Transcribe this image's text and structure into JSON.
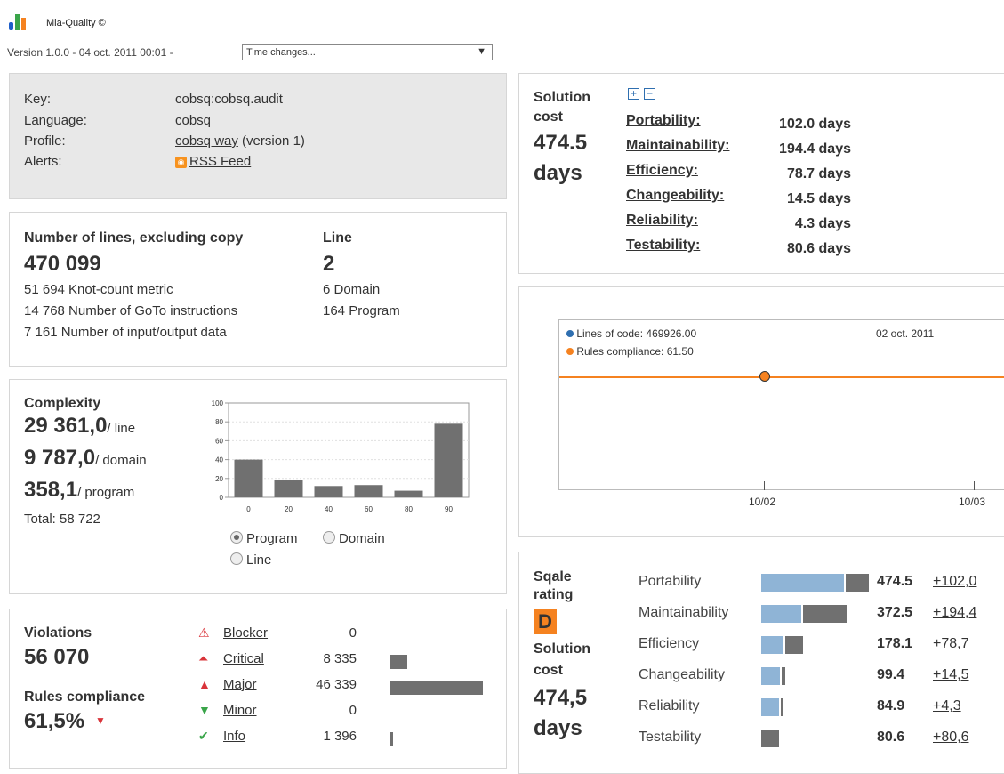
{
  "header": {
    "app_title": "Mia-Quality ©",
    "version_line": "Version 1.0.0 - 04 oct. 2011 00:01 -",
    "time_select": "Time changes..."
  },
  "key_panel": {
    "rows": [
      {
        "label": "Key:",
        "value": "cobsq:cobsq.audit"
      },
      {
        "label": "Language:",
        "value": "cobsq"
      },
      {
        "label": "Profile:",
        "link": "cobsq way",
        "suffix": "(version 1)"
      },
      {
        "label": "Alerts:",
        "link": "RSS Feed"
      }
    ]
  },
  "lines_panel": {
    "title": "Number of lines, excluding copy",
    "value": "470 099",
    "details": [
      "51 694 Knot-count metric",
      "14 768 Number of GoTo instructions",
      "7 161 Number of input/output data"
    ],
    "line_title": "Line",
    "line_value": "2",
    "line_details": [
      "6 Domain",
      "164 Program"
    ]
  },
  "complexity": {
    "title": "Complexity",
    "per_line": "29 361,0",
    "per_line_unit": "/ line",
    "per_domain": "9 787,0",
    "per_domain_unit": "/ domain",
    "per_program": "358,1",
    "per_program_unit": "/ program",
    "total": "Total: 58 722",
    "radios": [
      {
        "label": "Program",
        "checked": true
      },
      {
        "label": "Domain",
        "checked": false
      },
      {
        "label": "Line",
        "checked": false
      }
    ]
  },
  "chart_data": {
    "type": "bar",
    "categories": [
      "0",
      "20",
      "40",
      "60",
      "80",
      "90"
    ],
    "values": [
      40,
      18,
      12,
      13,
      7,
      78
    ],
    "yticks": [
      "0",
      "20",
      "40",
      "60",
      "80",
      "100"
    ],
    "ylim": [
      0,
      100
    ],
    "bar_color": "#707070"
  },
  "violations": {
    "title": "Violations",
    "value": "56 070",
    "compliance_title": "Rules compliance",
    "compliance_value": "61,5%",
    "severities": [
      {
        "name": "Blocker",
        "count": "0",
        "share": 0,
        "icon": "blocker-icon"
      },
      {
        "name": "Critical",
        "count": "8 335",
        "share": 0.18,
        "icon": "critical-icon"
      },
      {
        "name": "Major",
        "count": "46 339",
        "share": 1.0,
        "icon": "major-icon"
      },
      {
        "name": "Minor",
        "count": "0",
        "share": 0,
        "icon": "minor-icon"
      },
      {
        "name": "Info",
        "count": "1 396",
        "share": 0.03,
        "icon": "info-icon"
      }
    ]
  },
  "solution_cost": {
    "title_line1": "Solution",
    "title_line2": "cost",
    "value": "474.5",
    "unit": "days",
    "items": [
      {
        "name": "Portability:",
        "value": "102.0 days"
      },
      {
        "name": "Maintainability:",
        "value": "194.4 days"
      },
      {
        "name": "Efficiency:",
        "value": "78.7 days"
      },
      {
        "name": "Changeability:",
        "value": "14.5 days"
      },
      {
        "name": "Reliability:",
        "value": "4.3 days"
      },
      {
        "name": "Testability:",
        "value": "80.6 days"
      }
    ]
  },
  "timeline": {
    "legend": [
      {
        "label": "Lines of code: 469926.00",
        "color": "#2f6fb0"
      },
      {
        "label": "Rules compliance: 61.50",
        "color": "#f58220"
      }
    ],
    "date": "02 oct. 2011",
    "ticks": [
      "10/02",
      "10/03"
    ],
    "line_color": "#f58220"
  },
  "sqale": {
    "rating_title": "Sqale rating",
    "rating": "D",
    "rating_color": "#f58220",
    "cost_title_line1": "Solution",
    "cost_title_line2": "cost",
    "cost_value": "474,5",
    "cost_unit": "days",
    "rows": [
      {
        "name": "Portability",
        "total": "474.5",
        "delta": "+102,0",
        "base": 0.372,
        "own": 0.102
      },
      {
        "name": "Maintainability",
        "total": "372.5",
        "delta": "+194,4",
        "base": 0.178,
        "own": 0.194
      },
      {
        "name": "Efficiency",
        "total": "178.1",
        "delta": "+78,7",
        "base": 0.099,
        "own": 0.079
      },
      {
        "name": "Changeability",
        "total": "99.4",
        "delta": "+14,5",
        "base": 0.085,
        "own": 0.015
      },
      {
        "name": "Reliability",
        "total": "84.9",
        "delta": "+4,3",
        "base": 0.081,
        "own": 0.004
      },
      {
        "name": "Testability",
        "total": "80.6",
        "delta": "+80,6",
        "base": 0,
        "own": 0.081
      }
    ],
    "base_color": "#8fb4d6",
    "own_color": "#707070"
  }
}
